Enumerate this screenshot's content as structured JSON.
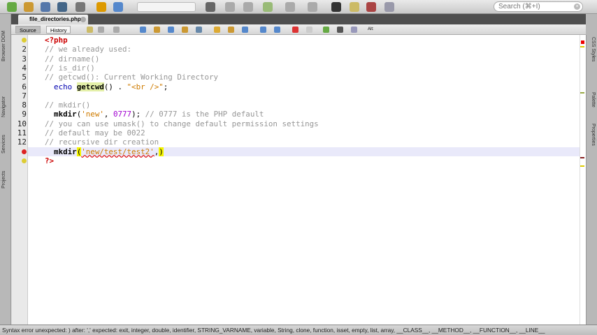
{
  "toolbar": {
    "search_placeholder": "Search (⌘+I)",
    "icons": [
      "new-file",
      "new-project",
      "open-project",
      "save-all",
      "preview",
      "undo",
      "redo",
      "browser",
      "build",
      "clean-build",
      "run",
      "debug",
      "profile",
      "terminal",
      "file",
      "git",
      "settings"
    ]
  },
  "tab": {
    "filename": "file_directories.php"
  },
  "editor_toolbar": {
    "source_label": "Source",
    "history_label": "History",
    "alt_label": "Alt:"
  },
  "left_sidebar": [
    "Browser DOM",
    "Navigator",
    "Services",
    "Projects"
  ],
  "right_sidebar": [
    "CSS Styles",
    "Palette",
    "Properties"
  ],
  "code_lines": [
    {
      "num": "",
      "marker": "warning",
      "tokens": [
        {
          "t": "<?php",
          "c": "php"
        }
      ]
    },
    {
      "num": "2",
      "tokens": [
        {
          "t": "// we already used:",
          "c": "c"
        }
      ]
    },
    {
      "num": "3",
      "tokens": [
        {
          "t": "// dirname()",
          "c": "c"
        }
      ]
    },
    {
      "num": "4",
      "tokens": [
        {
          "t": "// is_dir()",
          "c": "c"
        }
      ]
    },
    {
      "num": "5",
      "tokens": [
        {
          "t": "// getcwd(): Current Working Directory",
          "c": "c"
        }
      ]
    },
    {
      "num": "6",
      "tokens": [
        {
          "t": "  echo ",
          "c": "kw"
        },
        {
          "t": "getcwd",
          "c": "fn hl"
        },
        {
          "t": "() . ",
          "c": "p"
        },
        {
          "t": "\"<br />\"",
          "c": "s"
        },
        {
          "t": ";",
          "c": "p"
        }
      ]
    },
    {
      "num": "7",
      "tokens": []
    },
    {
      "num": "8",
      "tokens": [
        {
          "t": "// mkdir()",
          "c": "c"
        }
      ]
    },
    {
      "num": "9",
      "tokens": [
        {
          "t": "  mkdir",
          "c": "fn"
        },
        {
          "t": "(",
          "c": "p"
        },
        {
          "t": "'new'",
          "c": "s"
        },
        {
          "t": ", ",
          "c": "p"
        },
        {
          "t": "0777",
          "c": "n"
        },
        {
          "t": "); ",
          "c": "p"
        },
        {
          "t": "// 0777 is the PHP default",
          "c": "c"
        }
      ]
    },
    {
      "num": "10",
      "tokens": [
        {
          "t": "// you can use umask() to change default permission settings",
          "c": "c"
        }
      ]
    },
    {
      "num": "11",
      "tokens": [
        {
          "t": "// default may be 0022",
          "c": "c"
        }
      ]
    },
    {
      "num": "12",
      "tokens": [
        {
          "t": "// recursive dir creation",
          "c": "c"
        }
      ]
    },
    {
      "num": "",
      "marker": "error",
      "current": true,
      "tokens": [
        {
          "t": "  mkdir",
          "c": "fn"
        },
        {
          "t": "(",
          "c": "p y"
        },
        {
          "t": "'new/test/test2'",
          "c": "err"
        },
        {
          "t": ",",
          "c": "p"
        },
        {
          "t": ")",
          "c": "p y"
        }
      ]
    },
    {
      "num": "",
      "marker": "warning",
      "tokens": [
        {
          "t": "?>",
          "c": "php"
        }
      ]
    }
  ],
  "status": {
    "message": "Syntax error  unexpected: )  after: ','  expected: exit, integer, double, identifier, STRING_VARNAME, variable, String, clone, function, isset, empty, list, array, __CLASS__, __METHOD__, __FUNCTION__, __LINE__"
  }
}
